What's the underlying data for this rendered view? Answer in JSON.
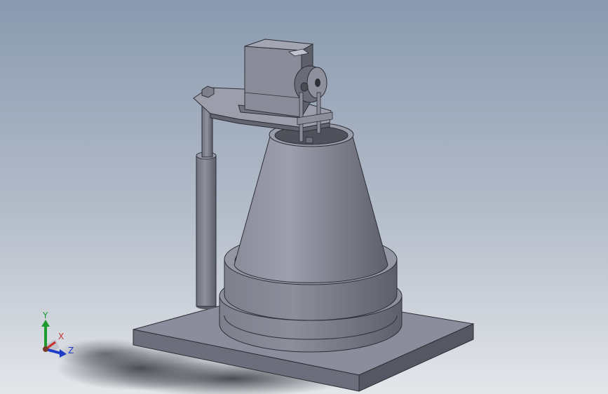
{
  "viewport": {
    "background": "#9eaabb"
  },
  "triad": {
    "y_label": "Y",
    "x_label": "X",
    "z_label": "Z",
    "colors": {
      "y": "#1f9a2c",
      "x": "#c8302c",
      "z": "#1e3cc8"
    }
  }
}
